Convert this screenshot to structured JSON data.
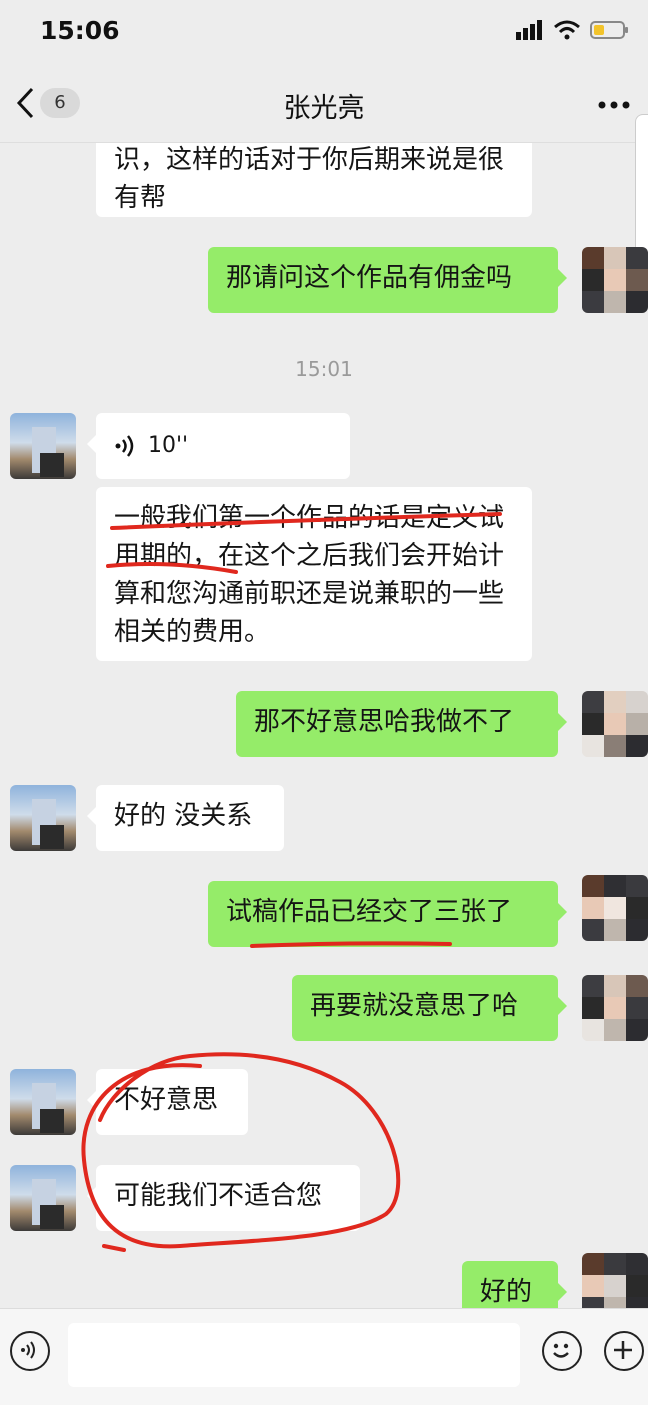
{
  "status": {
    "time": "15:06"
  },
  "header": {
    "back_count": "6",
    "title": "张光亮",
    "more_label": "···"
  },
  "messages": {
    "m0": "识，这样的话对于你后期来说是很有帮",
    "m1": "那请问这个作品有佣金吗",
    "ts": "15:01",
    "voice_duration": "10''",
    "m3": "一般我们第一个作品的话是定义试用期的，在这个之后我们会开始计算和您沟通前职还是说兼职的一些相关的费用。",
    "m4": "那不好意思哈我做不了",
    "m5": "好的 没关系",
    "m6": "试稿作品已经交了三张了",
    "m7": "再要就没意思了哈",
    "m8": "不好意思",
    "m9": "可能我们不适合您",
    "m10": "好的"
  },
  "colors": {
    "outgoing_bubble": "#95ec69",
    "incoming_bubble": "#ffffff",
    "annotation": "#e0281e"
  },
  "icons": [
    "chevron-left-icon",
    "more-icon",
    "voice-icon",
    "emoji-icon",
    "plus-icon",
    "signal-icon",
    "wifi-icon",
    "battery-icon"
  ]
}
